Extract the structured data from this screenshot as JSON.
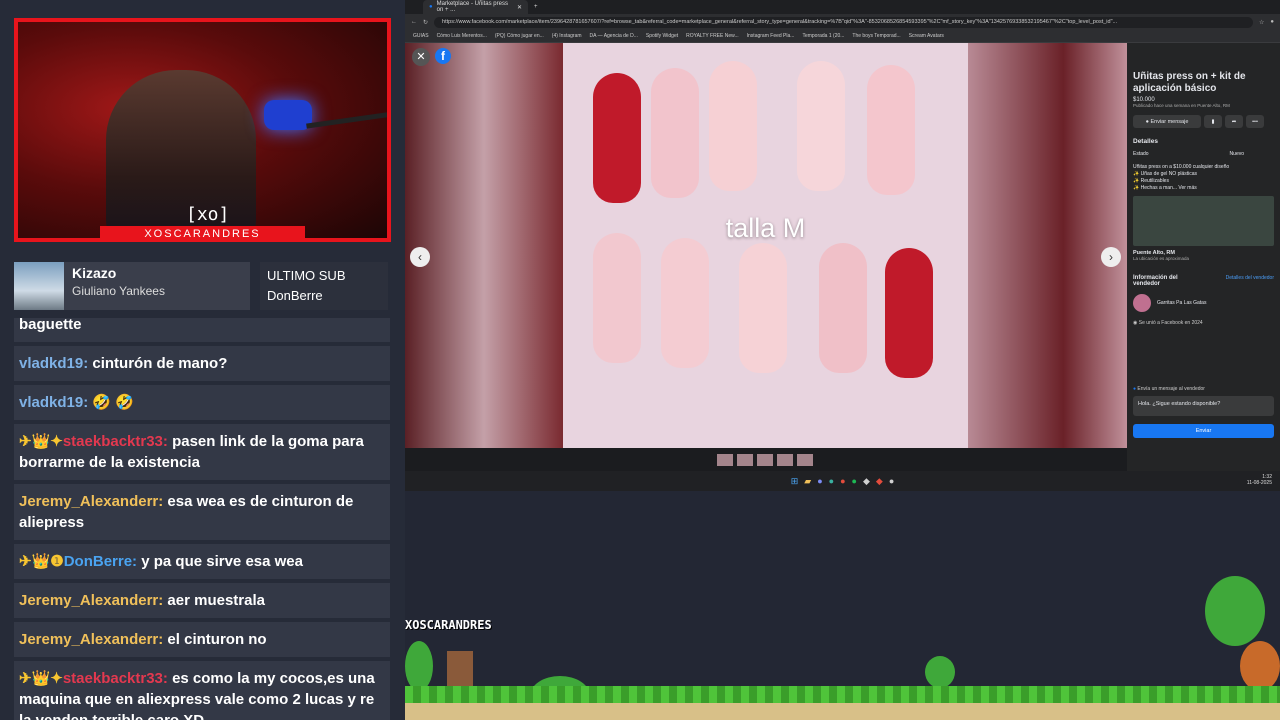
{
  "stream": {
    "cam_logo": "[xo]",
    "channel": "XOSCARANDRES"
  },
  "alert": {
    "name": "Kizazo",
    "sub": "Giuliano Yankees"
  },
  "last_sub": {
    "label": "ULTIMO SUB",
    "name": "DonBerre"
  },
  "chat": [
    {
      "user": "",
      "text": "baguette",
      "color": "#ffffff",
      "badges": ""
    },
    {
      "user": "vladkd19:",
      "text": " cinturón de mano?",
      "color": "#7fb2e6",
      "badges": ""
    },
    {
      "user": "vladkd19:",
      "text": " 🤣 🤣",
      "color": "#7fb2e6",
      "badges": ""
    },
    {
      "user": "staekbacktr33:",
      "text": " pasen link de la goma para borrarme de la existencia",
      "color": "#e3384f",
      "badges": "✈👑✦"
    },
    {
      "user": "Jeremy_Alexanderr:",
      "text": " esa wea es de cinturon de aliepress",
      "color": "#f0c05a",
      "badges": ""
    },
    {
      "user": "DonBerre:",
      "text": " y pa que sirve esa wea",
      "color": "#4aa3f0",
      "badges": "✈👑❶"
    },
    {
      "user": "Jeremy_Alexanderr:",
      "text": " aer muestrala",
      "color": "#f0c05a",
      "badges": ""
    },
    {
      "user": "Jeremy_Alexanderr:",
      "text": " el cinturon no",
      "color": "#f0c05a",
      "badges": ""
    },
    {
      "user": "staekbacktr33:",
      "text": " es como la my cocos,es una maquina que en aliexpress vale como 2 lucas y re la venden terrible caro XD",
      "color": "#e3384f",
      "badges": "✈👑✦"
    }
  ],
  "browser": {
    "tab_title": "Marketplace - Uñitas press on + ...",
    "url": "https://www.facebook.com/marketplace/item/2396428781657607/?ref=browse_tab&referral_code=marketplace_general&referral_story_type=general&tracking=%7B\"qid\"%3A\"-8532068526854593395\"%2C\"mf_story_key\"%3A\"13425769338532195467\"%2C\"top_level_post_id\"...",
    "bookmarks": [
      "GUIAS",
      "Cómo Luis Merentos...",
      "(PQ) Cómo jugar en...",
      "(4) Instagram",
      "DA — Agencia de D...",
      "Spotify Widget",
      "ROYALTY FREE New...",
      "Instagram Feed Pla...",
      "Temporada 1 (20...",
      "The boys Temporad...",
      "Scream Avatars"
    ]
  },
  "photo": {
    "overlay_text": "talla M"
  },
  "listing": {
    "title": "Uñitas press on + kit de aplicación básico",
    "price": "$10.000",
    "posted": "Publicado hace una semana en Puente Alto, RM",
    "send_message": "Enviar mensaje",
    "details_heading": "Detalles",
    "condition_label": "Estado",
    "condition_value": "Nuevo",
    "desc_lines": [
      "Uñitas press on a $10.000 cualquier diseño",
      "✨ Uñas de gel NO plásticas",
      "✨ Reutilizables",
      "✨ Hechas a man... Ver más"
    ],
    "location": "Puente Alto, RM",
    "location_note": "La ubicación es aproximada",
    "seller_heading": "Información del vendedor",
    "seller_details": "Detalles del vendedor",
    "seller_name": "Garritas Pa Las Gatas",
    "seller_joined": "Se unió a Facebook en 2024",
    "message_label": "Envía un mensaje al vendedor",
    "message_value": "Hola. ¿Sigue estando disponible?",
    "send_label": "Enviar"
  },
  "taskbar": {
    "time": "1:32",
    "date": "11-08-2025"
  },
  "game": {
    "tag": "XOSCARANDRES"
  },
  "colors": {
    "accent_red": "#e8141c",
    "fb_blue": "#1877f2"
  }
}
